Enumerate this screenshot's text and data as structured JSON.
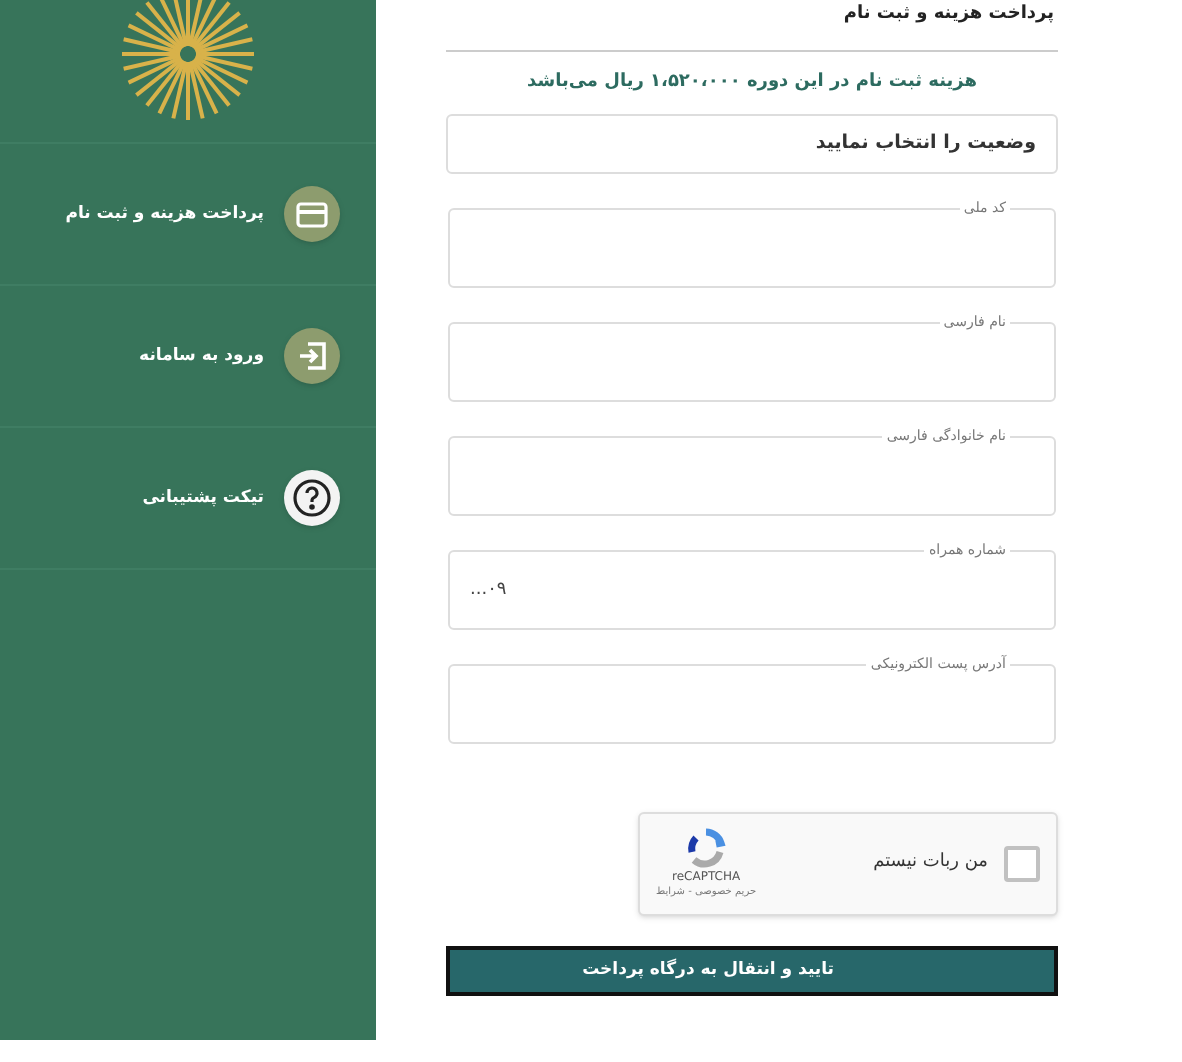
{
  "sidebar": {
    "items": [
      {
        "label": "پرداخت هزینه و ثبت نام",
        "kind": "card"
      },
      {
        "label": "ورود به سامانه",
        "kind": "login"
      },
      {
        "label": "تیکت پشتیبانی",
        "kind": "help"
      }
    ]
  },
  "page_title": "پرداخت هزینه و ثبت نام",
  "fee_notice": "هزینه ثبت نام در این دوره ۱،۵۲۰،۰۰۰ ریال می‌باشد",
  "status_select": {
    "value": "وضعیت را انتخاب نمایید"
  },
  "fields": [
    {
      "label": "کد ملی"
    },
    {
      "label": "نام فارسی"
    },
    {
      "label": "نام خانوادگی فارسی"
    },
    {
      "label": "شماره همراه",
      "placeholder": "۰۹..."
    },
    {
      "label": "آدرس پست الکترونیکی"
    }
  ],
  "captcha": {
    "label": "من ربات نیستم",
    "checked": false,
    "brand": "reCAPTCHA",
    "links": "حریم خصوصی - شرایط"
  },
  "submit_button": "تایید و انتقال به درگاه پرداخت"
}
